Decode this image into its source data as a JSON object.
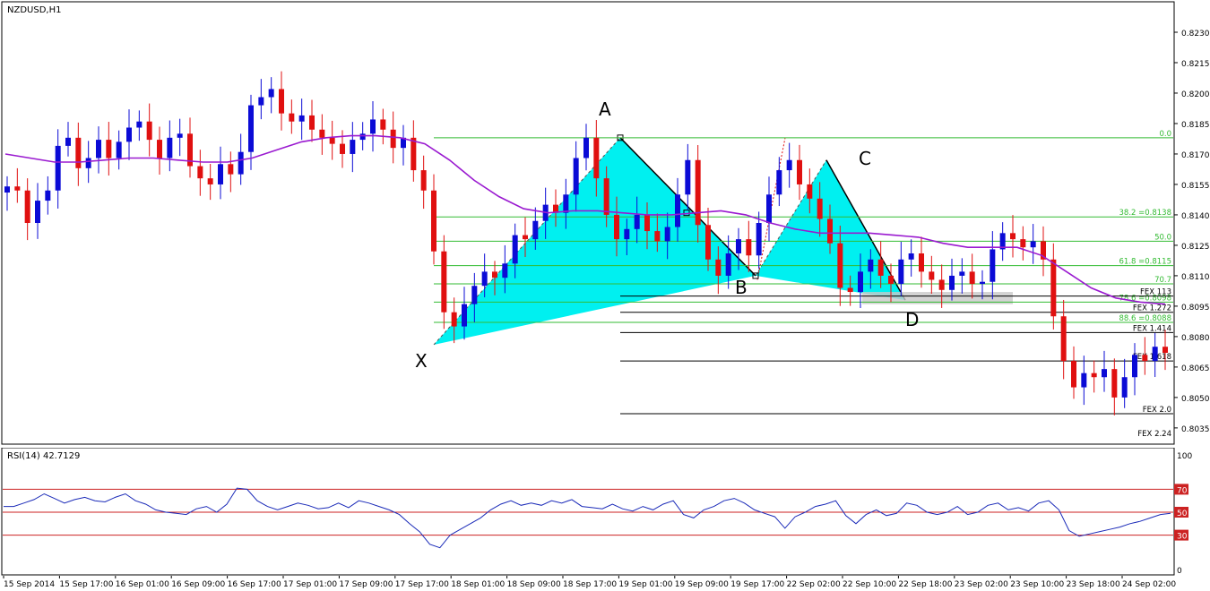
{
  "symbol_label": "NZDUSD,H1",
  "rsi_label": "RSI(14) 42.7129",
  "price_axis": {
    "ticks": [
      "0.8230",
      "0.8215",
      "0.8200",
      "0.8185",
      "0.8170",
      "0.8155",
      "0.8140",
      "0.8125",
      "0.8110",
      "0.8095",
      "0.8080",
      "0.8065",
      "0.8050",
      "0.8035"
    ]
  },
  "rsi_axis": {
    "ticks": [
      "100",
      "70",
      "50",
      "30",
      "0"
    ]
  },
  "time_axis": {
    "ticks": [
      "15 Sep 2014",
      "15 Sep 17:00",
      "16 Sep 01:00",
      "16 Sep 09:00",
      "16 Sep 17:00",
      "17 Sep 01:00",
      "17 Sep 09:00",
      "17 Sep 17:00",
      "18 Sep 01:00",
      "18 Sep 09:00",
      "18 Sep 17:00",
      "19 Sep 01:00",
      "19 Sep 09:00",
      "19 Sep 17:00",
      "22 Sep 02:00",
      "22 Sep 10:00",
      "22 Sep 18:00",
      "23 Sep 02:00",
      "23 Sep 10:00",
      "23 Sep 18:00",
      "24 Sep 02:00"
    ]
  },
  "pattern_points": [
    {
      "label": "X",
      "price": 0.8076
    },
    {
      "label": "A",
      "price": 0.8178
    },
    {
      "label": "B",
      "price": 0.811
    },
    {
      "label": "C",
      "price": 0.8167
    },
    {
      "label": "D",
      "price": 0.8098
    }
  ],
  "fib_levels": [
    {
      "label": "0.0",
      "price": 0.8178
    },
    {
      "label": "38.2 =0.8138",
      "price": 0.8139
    },
    {
      "label": "50.0",
      "price": 0.8127
    },
    {
      "label": "61.8 =0.8115",
      "price": 0.8115
    },
    {
      "label": "70.7",
      "price": 0.8106
    },
    {
      "label": "78.6 =0.8098",
      "price": 0.8097
    },
    {
      "label": "88.6 =0.8088",
      "price": 0.8087
    }
  ],
  "fex_levels": [
    {
      "label": "FEX 113",
      "price": 0.81
    },
    {
      "label": "FEX 1.272",
      "price": 0.8092
    },
    {
      "label": "FEX 1.414",
      "price": 0.8082
    },
    {
      "label": "FEX 1.618",
      "price": 0.8068
    },
    {
      "label": "FEX 2.0",
      "price": 0.8042
    },
    {
      "label": "FEX 2.24",
      "price": 0.803
    }
  ],
  "colors": {
    "bull": "#0b0bd6",
    "bear": "#e01010",
    "ma": "#9a1ad0",
    "fib": "#33bb33",
    "fill": "#00f0f0",
    "rsi": "#1a2ab8",
    "rsi_level": "#cc2222"
  },
  "chart_data": [
    {
      "type": "candlestick",
      "title": "NZDUSD,H1",
      "ylim": [
        0.8027,
        0.8245
      ],
      "x": [
        "15 Sep 2014",
        "15 Sep 17:00",
        "16 Sep 01:00",
        "16 Sep 09:00",
        "16 Sep 17:00",
        "17 Sep 01:00",
        "17 Sep 09:00",
        "17 Sep 17:00",
        "18 Sep 01:00",
        "18 Sep 09:00",
        "18 Sep 17:00",
        "19 Sep 01:00",
        "19 Sep 09:00",
        "19 Sep 17:00",
        "22 Sep 02:00",
        "22 Sep 10:00",
        "22 Sep 18:00",
        "23 Sep 02:00",
        "23 Sep 10:00",
        "23 Sep 18:00",
        "24 Sep 02:00"
      ],
      "close_path": [
        0.8154,
        0.8152,
        0.8136,
        0.8147,
        0.8152,
        0.8174,
        0.8178,
        0.8163,
        0.8168,
        0.8177,
        0.8168,
        0.8176,
        0.8183,
        0.8186,
        0.8177,
        0.8168,
        0.8178,
        0.818,
        0.8164,
        0.8158,
        0.8155,
        0.8165,
        0.816,
        0.8171,
        0.8194,
        0.8198,
        0.8202,
        0.819,
        0.8186,
        0.8189,
        0.8182,
        0.8178,
        0.8175,
        0.817,
        0.8177,
        0.818,
        0.8187,
        0.8182,
        0.8173,
        0.8178,
        0.8162,
        0.8152,
        0.8122,
        0.8092,
        0.8085,
        0.8096,
        0.8105,
        0.8112,
        0.8109,
        0.8116,
        0.813,
        0.8128,
        0.8137,
        0.8145,
        0.8141,
        0.815,
        0.8168,
        0.8178,
        0.8158,
        0.814,
        0.8128,
        0.8133,
        0.814,
        0.8132,
        0.8127,
        0.8134,
        0.815,
        0.8167,
        0.8135,
        0.8118,
        0.811,
        0.8121,
        0.8128,
        0.812,
        0.8136,
        0.815,
        0.8162,
        0.8167,
        0.8155,
        0.8148,
        0.8138,
        0.8126,
        0.8104,
        0.8102,
        0.8112,
        0.8118,
        0.811,
        0.8106,
        0.8118,
        0.8121,
        0.8112,
        0.8108,
        0.8103,
        0.811,
        0.8112,
        0.8106,
        0.8107,
        0.8123,
        0.8131,
        0.8128,
        0.8124,
        0.8127,
        0.8118,
        0.809,
        0.8068,
        0.8055,
        0.8062,
        0.806,
        0.8064,
        0.805,
        0.806,
        0.8071,
        0.8068,
        0.8075,
        0.8072
      ]
    },
    {
      "type": "line",
      "name": "MA",
      "values": [
        0.817,
        0.8168,
        0.8166,
        0.8166,
        0.8167,
        0.8168,
        0.8168,
        0.8167,
        0.8166,
        0.8166,
        0.8168,
        0.8172,
        0.8176,
        0.8178,
        0.8179,
        0.8179,
        0.8178,
        0.8175,
        0.8167,
        0.8157,
        0.8149,
        0.8143,
        0.8141,
        0.8142,
        0.8142,
        0.8141,
        0.814,
        0.814,
        0.8141,
        0.8142,
        0.814,
        0.8136,
        0.8133,
        0.8131,
        0.8131,
        0.8131,
        0.813,
        0.8129,
        0.8126,
        0.8124,
        0.8124,
        0.8124,
        0.812,
        0.8112,
        0.8104,
        0.8099,
        0.8097,
        0.8096
      ]
    },
    {
      "type": "line",
      "title": "RSI(14) 42.7129",
      "ylim": [
        0,
        100
      ],
      "levels": [
        70,
        50,
        30
      ],
      "values": [
        55,
        55,
        58,
        61,
        66,
        62,
        58,
        61,
        63,
        60,
        59,
        63,
        66,
        60,
        57,
        52,
        50,
        49,
        48,
        53,
        55,
        50,
        57,
        71,
        70,
        60,
        55,
        52,
        55,
        58,
        56,
        53,
        54,
        58,
        54,
        60,
        58,
        55,
        52,
        48,
        40,
        33,
        22,
        19,
        30,
        35,
        40,
        45,
        52,
        57,
        60,
        56,
        58,
        56,
        60,
        58,
        61,
        55,
        54,
        53,
        57,
        53,
        51,
        55,
        52,
        57,
        60,
        48,
        45,
        52,
        55,
        60,
        62,
        58,
        52,
        49,
        46,
        36,
        46,
        50,
        55,
        57,
        60,
        47,
        40,
        48,
        52,
        47,
        49,
        58,
        56,
        50,
        48,
        50,
        55,
        48,
        50,
        56,
        58,
        52,
        54,
        51,
        58,
        60,
        52,
        34,
        29,
        31,
        33,
        35,
        37,
        40,
        42,
        45,
        48,
        49
      ]
    }
  ]
}
